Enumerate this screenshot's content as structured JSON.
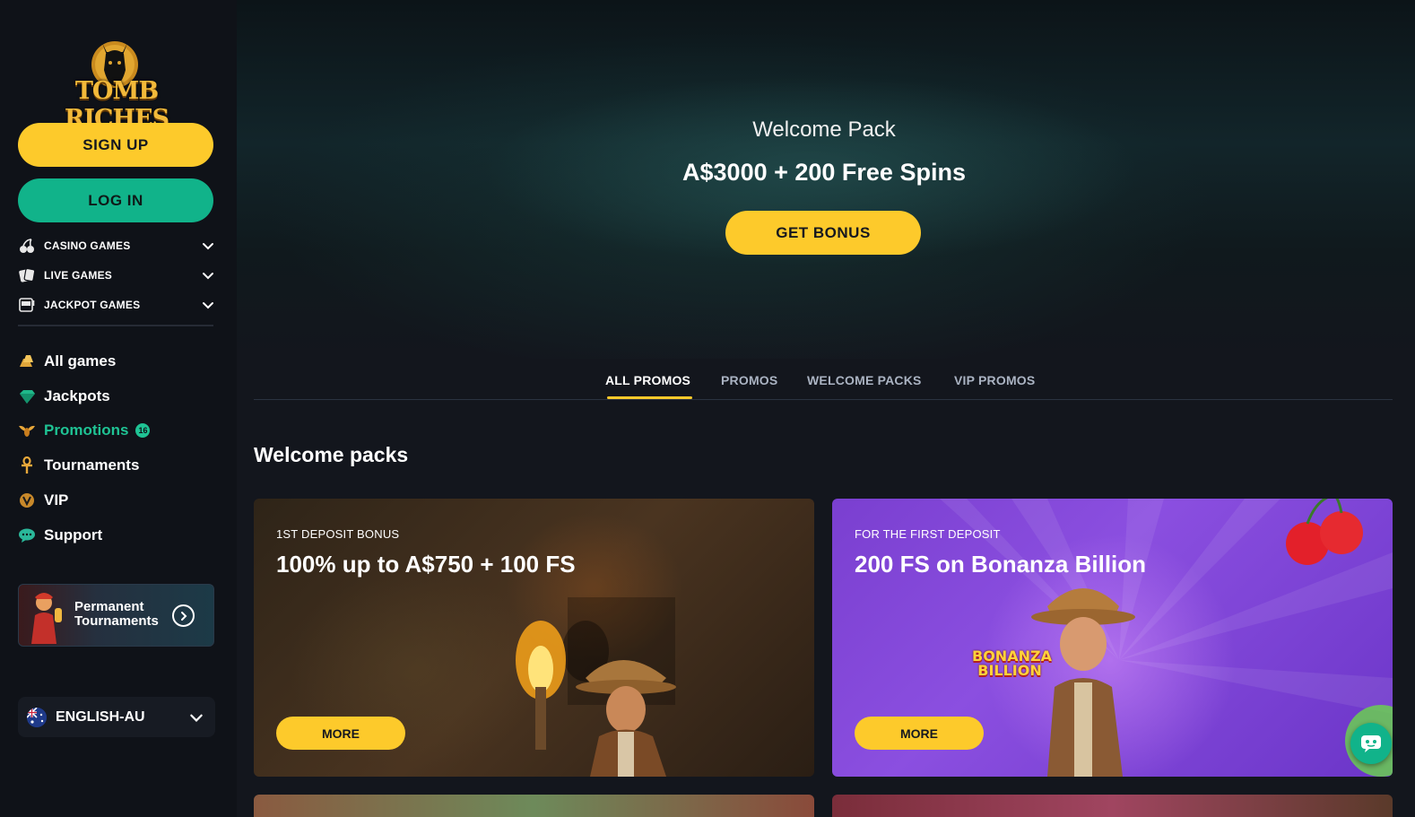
{
  "brand": {
    "logo_text": "TOMB RICHES"
  },
  "auth": {
    "signup_label": "SIGN UP",
    "login_label": "LOG IN"
  },
  "categories": [
    {
      "label": "CASINO GAMES",
      "icon": "cherries-icon"
    },
    {
      "label": "LIVE GAMES",
      "icon": "cards-icon"
    },
    {
      "label": "JACKPOT GAMES",
      "icon": "slot-machine-icon"
    }
  ],
  "nav": [
    {
      "label": "All games",
      "icon": "gold-bars-icon"
    },
    {
      "label": "Jackpots",
      "icon": "gem-icon"
    },
    {
      "label": "Promotions",
      "icon": "winged-scarab-icon",
      "badge": "16",
      "active": true
    },
    {
      "label": "Tournaments",
      "icon": "ankh-icon"
    },
    {
      "label": "VIP",
      "icon": "vip-emblem-icon"
    },
    {
      "label": "Support",
      "icon": "chat-bubble-icon"
    }
  ],
  "tournament_banner": {
    "line1": "Permanent",
    "line2": "Tournaments"
  },
  "language": {
    "label": "ENGLISH-AU"
  },
  "hero": {
    "subtitle": "Welcome Pack",
    "title": "A$3000 + 200 Free Spins",
    "button_label": "GET BONUS"
  },
  "tabs": [
    {
      "label": "ALL PROMOS",
      "active": true
    },
    {
      "label": "PROMOS"
    },
    {
      "label": "WELCOME PACKS"
    },
    {
      "label": "VIP PROMOS"
    }
  ],
  "section": {
    "title": "Welcome packs"
  },
  "cards": [
    {
      "kicker": "1ST DEPOSIT BONUS",
      "title": "100% up to A$750 + 100 FS",
      "button_label": "MORE"
    },
    {
      "kicker": "FOR THE FIRST DEPOSIT",
      "title": "200 FS on Bonanza Billion",
      "button_label": "MORE",
      "game_logo": "BONANZA BILLION"
    }
  ],
  "colors": {
    "accent_yellow": "#fdca2b",
    "accent_green": "#11b38a",
    "sidebar_bg": "#0f1218",
    "page_bg": "#13161d"
  }
}
